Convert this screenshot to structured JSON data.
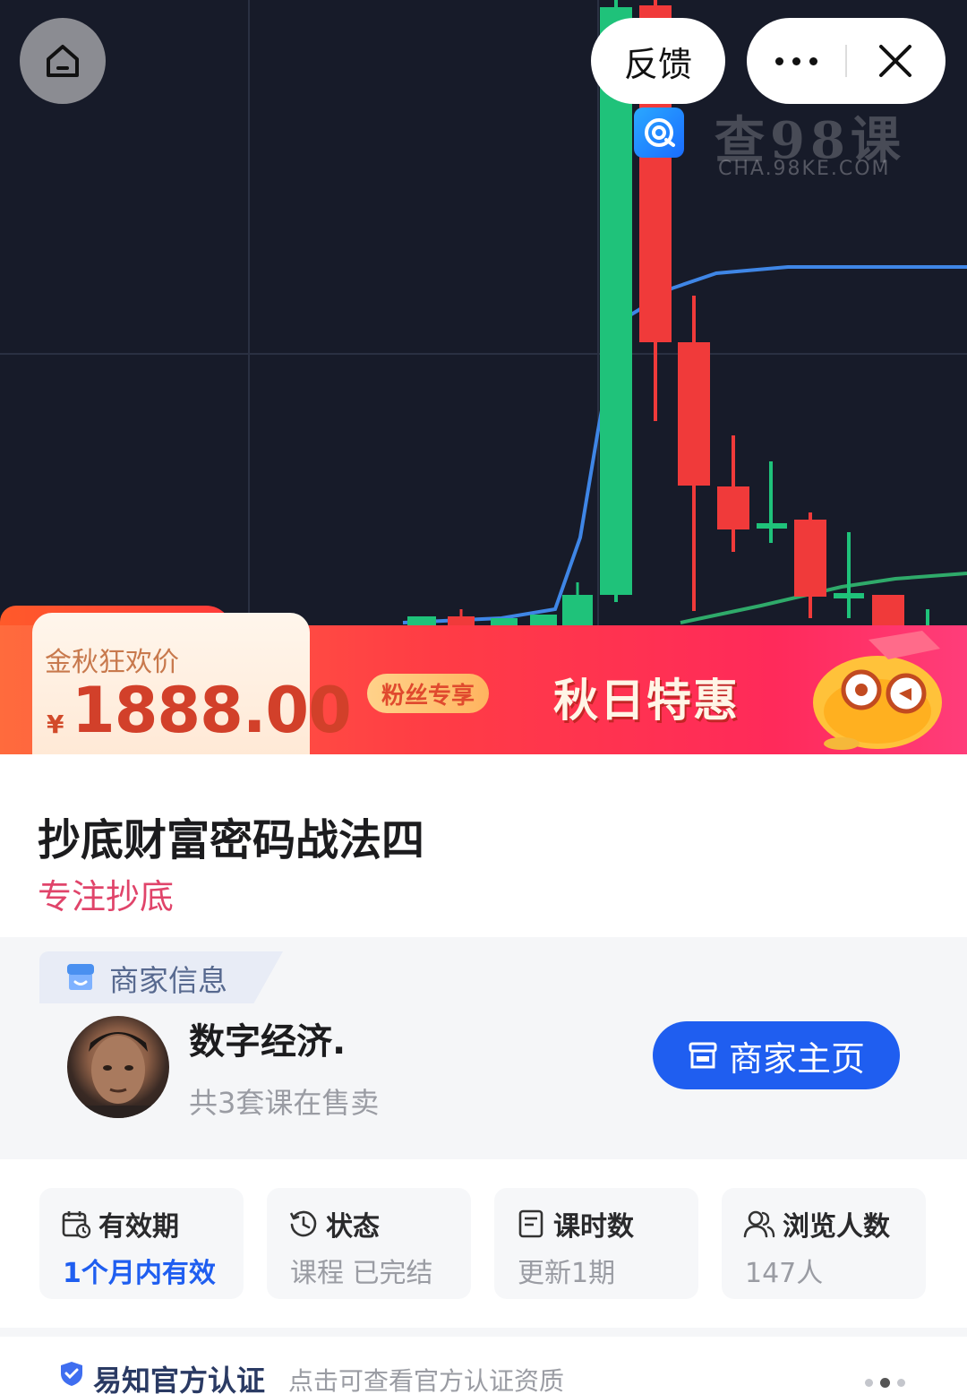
{
  "nav": {
    "feedback_label": "反馈"
  },
  "watermark": {
    "title": "查98课",
    "url": "CHA.98KE.COM"
  },
  "banner": {
    "price_label": "金秋狂欢价",
    "currency": "¥",
    "price": "1888.00",
    "fans_tag": "粉丝专享",
    "promo_title": "秋日特惠"
  },
  "course": {
    "title": "抄底财富密码战法四",
    "subtitle": "专注抄底"
  },
  "merchant": {
    "section_label": "商家信息",
    "name": "数字经济.",
    "courses_count": "共3套课在售卖",
    "home_button": "商家主页"
  },
  "stats": [
    {
      "label": "有效期",
      "value": "1个月内有效",
      "icon": "calendar-clock-icon"
    },
    {
      "label": "状态",
      "value": "课程 已完结",
      "icon": "history-icon"
    },
    {
      "label": "课时数",
      "value": "更新1期",
      "icon": "document-icon"
    },
    {
      "label": "浏览人数",
      "value": "147人",
      "icon": "users-icon"
    }
  ],
  "certification": {
    "title": "易知官方认证",
    "description": "点击可查看官方认证资质"
  },
  "colors": {
    "chart_bg": "#171b29",
    "candle_up": "#1fc27a",
    "candle_down": "#f03a3a",
    "ma_blue": "#3f86e6",
    "ma_green": "#2faa6a",
    "price_red": "#d2402a",
    "accent_blue": "#1f5ef0",
    "subtitle_pink": "#e0446a"
  }
}
